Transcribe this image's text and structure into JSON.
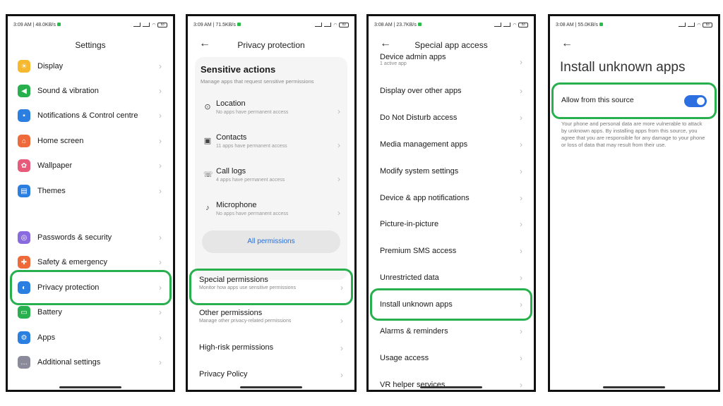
{
  "panel1": {
    "status": {
      "time": "3:09 AM",
      "speed": "48.0KB/s",
      "battery": "83"
    },
    "title": "Settings",
    "items": [
      {
        "label": "Display",
        "icon": "sun-icon",
        "color": "#f5b82e"
      },
      {
        "label": "Sound & vibration",
        "icon": "speaker-icon",
        "color": "#27b04d"
      },
      {
        "label": "Notifications & Control centre",
        "icon": "notification-icon",
        "color": "#2b7fe0"
      },
      {
        "label": "Home screen",
        "icon": "home-icon",
        "color": "#ef6a3a"
      },
      {
        "label": "Wallpaper",
        "icon": "wallpaper-icon",
        "color": "#e85a7a"
      },
      {
        "label": "Themes",
        "icon": "themes-icon",
        "color": "#2b7fe0"
      },
      {
        "label": "Passwords & security",
        "icon": "password-icon",
        "color": "#8a6adf"
      },
      {
        "label": "Safety & emergency",
        "icon": "emergency-icon",
        "color": "#ef6a3a"
      },
      {
        "label": "Privacy protection",
        "icon": "privacy-icon",
        "color": "#2b7fe0"
      },
      {
        "label": "Battery",
        "icon": "battery-icon",
        "color": "#27b04d"
      },
      {
        "label": "Apps",
        "icon": "apps-icon",
        "color": "#2b7fe0"
      },
      {
        "label": "Additional settings",
        "icon": "more-icon",
        "color": "#8a8a9a"
      }
    ]
  },
  "panel2": {
    "status": {
      "time": "3:09 AM",
      "speed": "71.5KB/s",
      "battery": "83"
    },
    "title": "Privacy protection",
    "section_title": "Sensitive actions",
    "section_sub": "Manage apps that request sensitive permissions",
    "perms": [
      {
        "title": "Location",
        "desc": "No apps have permanent access",
        "icon": "location-icon"
      },
      {
        "title": "Contacts",
        "desc": "11 apps have permanent access",
        "icon": "contacts-icon"
      },
      {
        "title": "Call logs",
        "desc": "4 apps have permanent access",
        "icon": "call-log-icon"
      },
      {
        "title": "Microphone",
        "desc": "No apps have permanent access",
        "icon": "microphone-icon"
      }
    ],
    "all_permissions": "All permissions",
    "special": {
      "title": "Special permissions",
      "desc": "Monitor how apps use sensitive permissions"
    },
    "other": {
      "title": "Other permissions",
      "desc": "Manage other privacy-related permissions"
    },
    "high_risk": "High-risk permissions",
    "privacy_policy": "Privacy Policy"
  },
  "panel3": {
    "status": {
      "time": "3:08 AM",
      "speed": "23.7KB/s",
      "battery": "83"
    },
    "title": "Special app access",
    "top_item": {
      "title": "Device admin apps",
      "desc": "1 active app"
    },
    "items": [
      "Display over other apps",
      "Do Not Disturb access",
      "Media management apps",
      "Modify system settings",
      "Device & app notifications",
      "Picture-in-picture",
      "Premium SMS access",
      "Unrestricted data",
      "Install unknown apps",
      "Alarms & reminders",
      "Usage access",
      "VR helper services"
    ]
  },
  "panel4": {
    "status": {
      "time": "3:08 AM",
      "speed": "55.0KB/s",
      "battery": "83"
    },
    "title": "Install unknown apps",
    "allow_label": "Allow from this source",
    "toggle_on": true,
    "warning": "Your phone and personal data are more vulnerable to attack by unknown apps. By installing apps from this source, you agree that you are responsible for any damage to your phone or loss of data that may result from their use."
  },
  "colors": {
    "highlight": "#27b04d",
    "toggle": "#2b6fe0",
    "link": "#2a6fd6"
  }
}
